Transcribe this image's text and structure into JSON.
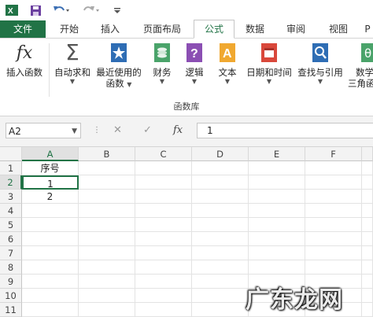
{
  "tabs": {
    "file": "文件",
    "items": [
      "开始",
      "插入",
      "页面布局",
      "公式",
      "数据",
      "审阅",
      "视图",
      "P"
    ],
    "active": "公式"
  },
  "ribbon": {
    "insert_function": "插入函数",
    "autosum": "自动求和",
    "recent_line1": "最近使用的",
    "recent_line2": "函数",
    "finance": "财务",
    "logic": "逻辑",
    "text": "文本",
    "datetime": "日期和时间",
    "lookup": "查找与引用",
    "math_line1": "数学",
    "math_line2": "三角函",
    "group_label": "函数库"
  },
  "formula_bar": {
    "name_box": "A2",
    "fx_label": "fx",
    "value": "1"
  },
  "grid": {
    "columns": [
      "A",
      "B",
      "C",
      "D",
      "E",
      "F"
    ],
    "rows": [
      "1",
      "2",
      "3",
      "4",
      "5",
      "6",
      "7",
      "8",
      "9",
      "10",
      "11"
    ],
    "cells": {
      "A1": "序号",
      "A2": "1",
      "A3": "2"
    },
    "active_cell": "A2"
  },
  "watermark": "广东龙网",
  "colors": {
    "excel_green": "#217346"
  }
}
